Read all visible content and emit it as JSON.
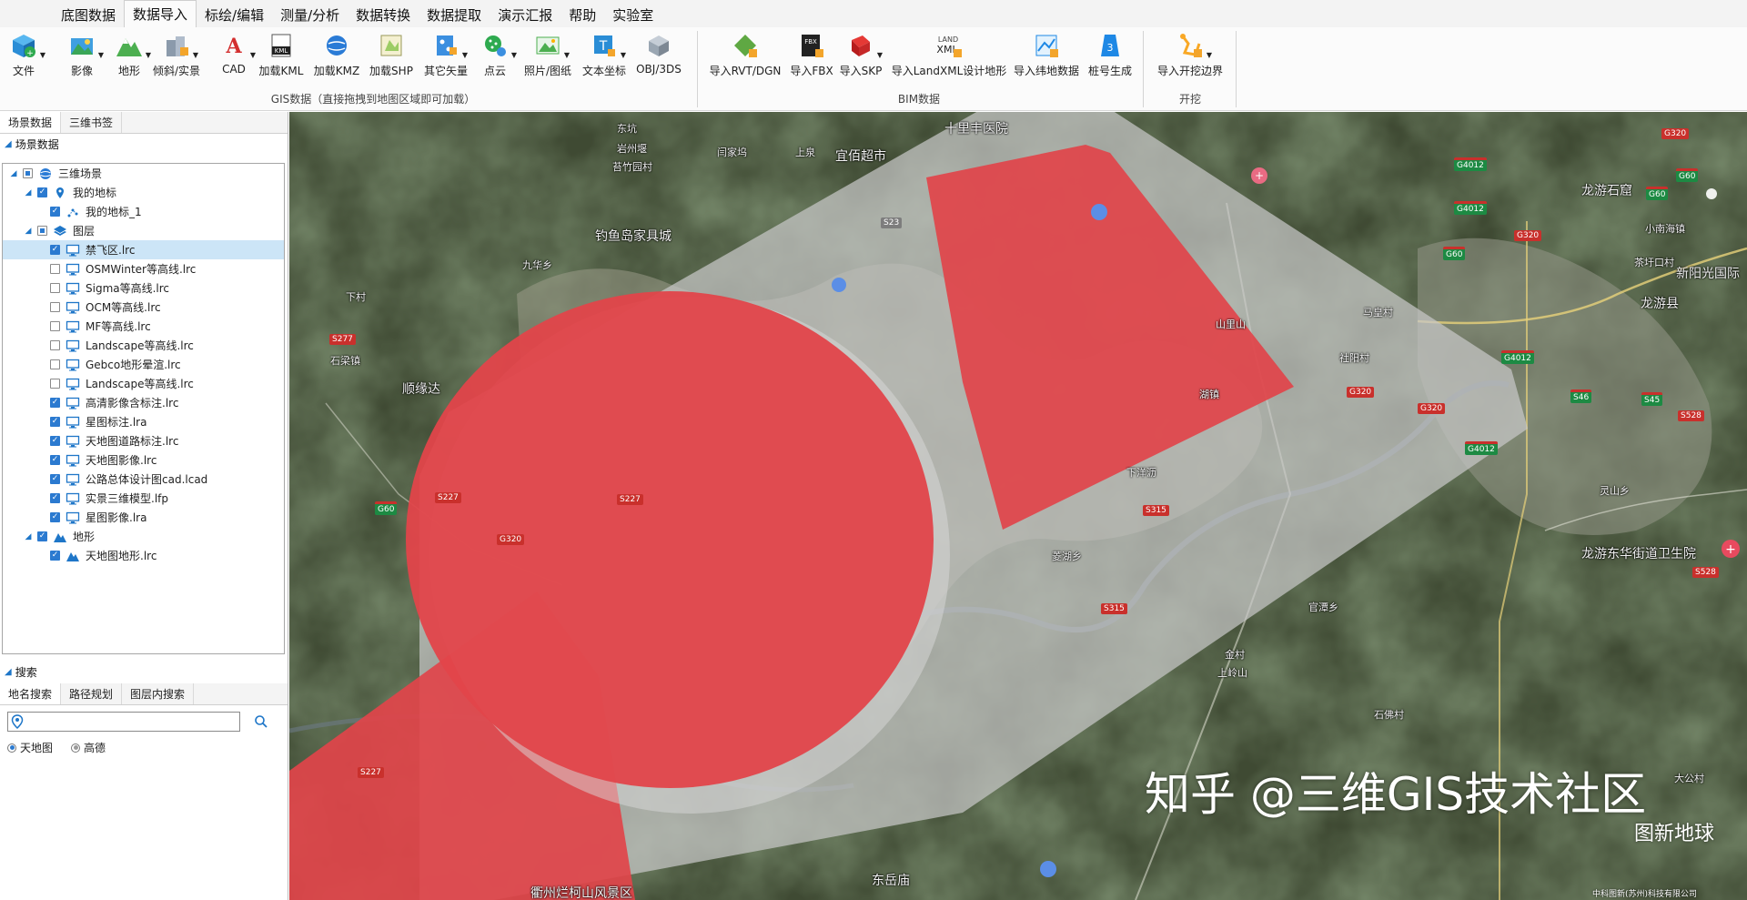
{
  "menu": {
    "tabs": [
      "底图数据",
      "数据导入",
      "标绘/编辑",
      "测量/分析",
      "数据转换",
      "数据提取",
      "演示汇报",
      "帮助",
      "实验室"
    ],
    "active_index": 1
  },
  "ribbon": {
    "file_label": "文件",
    "gis_buttons": [
      "影像",
      "地形",
      "倾斜/实景",
      "CAD",
      "加载KML",
      "加载KMZ",
      "加载SHP",
      "其它矢量",
      "点云",
      "照片/图纸",
      "文本坐标",
      "OBJ/3DS"
    ],
    "gis_group_label": "GIS数据（直接拖拽到地图区域即可加载）",
    "bim_buttons": [
      "导入RVT/DGN",
      "导入FBX",
      "导入SKP",
      "导入LandXML设计地形",
      "导入纬地数据",
      "桩号生成"
    ],
    "bim_group_label": "BIM数据",
    "excavation_buttons": [
      "导入开挖边界"
    ],
    "excavation_group_label": "开挖",
    "icon_text": {
      "kml": "KML",
      "fbx": "FBX",
      "landxml_1": "LAND",
      "landxml_2": "XML",
      "stake": "3"
    }
  },
  "left_panel": {
    "tabs": [
      "场景数据",
      "三维书签"
    ],
    "section_title": "场景数据",
    "tree": [
      {
        "label": "三维场景",
        "level": 0,
        "expanded": true,
        "check": "partial",
        "icon": "globe-icon"
      },
      {
        "label": "我的地标",
        "level": 1,
        "expanded": true,
        "check": "checked",
        "icon": "placemark-icon"
      },
      {
        "label": "我的地标_1",
        "level": 2,
        "check": "checked",
        "icon": "polyline-icon"
      },
      {
        "label": "图层",
        "level": 1,
        "expanded": true,
        "check": "partial",
        "icon": "layers-icon"
      },
      {
        "label": "禁飞区.lrc",
        "level": 2,
        "check": "checked",
        "icon": "monitor-icon",
        "selected": true
      },
      {
        "label": "OSMWinter等高线.lrc",
        "level": 2,
        "check": "unchecked",
        "icon": "monitor-icon"
      },
      {
        "label": "Sigma等高线.lrc",
        "level": 2,
        "check": "unchecked",
        "icon": "monitor-icon"
      },
      {
        "label": "OCM等高线.lrc",
        "level": 2,
        "check": "unchecked",
        "icon": "monitor-icon"
      },
      {
        "label": "MF等高线.lrc",
        "level": 2,
        "check": "unchecked",
        "icon": "monitor-icon"
      },
      {
        "label": "Landscape等高线.lrc",
        "level": 2,
        "check": "unchecked",
        "icon": "monitor-icon"
      },
      {
        "label": "Gebco地形晕渲.lrc",
        "level": 2,
        "check": "unchecked",
        "icon": "monitor-icon"
      },
      {
        "label": "Landscape等高线.lrc",
        "level": 2,
        "check": "unchecked",
        "icon": "monitor-icon"
      },
      {
        "label": "高清影像含标注.lrc",
        "level": 2,
        "check": "checked",
        "icon": "monitor-icon"
      },
      {
        "label": "星图标注.lra",
        "level": 2,
        "check": "checked",
        "icon": "monitor-icon"
      },
      {
        "label": "天地图道路标注.lrc",
        "level": 2,
        "check": "checked",
        "icon": "monitor-icon"
      },
      {
        "label": "天地图影像.lrc",
        "level": 2,
        "check": "checked",
        "icon": "monitor-icon"
      },
      {
        "label": "公路总体设计图cad.lcad",
        "level": 2,
        "check": "checked",
        "icon": "monitor-icon"
      },
      {
        "label": "实景三维模型.lfp",
        "level": 2,
        "check": "checked",
        "icon": "monitor-icon"
      },
      {
        "label": "星图影像.lra",
        "level": 2,
        "check": "checked",
        "icon": "monitor-icon"
      },
      {
        "label": "地形",
        "level": 1,
        "expanded": true,
        "check": "checked",
        "icon": "terrain-icon"
      },
      {
        "label": "天地图地形.lrc",
        "level": 2,
        "check": "checked",
        "icon": "terrain-icon"
      }
    ]
  },
  "search": {
    "section_title": "搜索",
    "tabs": [
      "地名搜索",
      "路径规划",
      "图层内搜索"
    ],
    "input_value": "",
    "providers": [
      {
        "label": "天地图",
        "selected": true
      },
      {
        "label": "高德",
        "selected": false
      }
    ]
  },
  "map": {
    "labels": [
      {
        "text": "十里丰医院",
        "cls": "mid"
      },
      {
        "text": "宜佰超市",
        "cls": "mid"
      },
      {
        "text": "钓鱼岛家具城",
        "cls": "mid"
      },
      {
        "text": "顺缘达",
        "cls": "mid"
      },
      {
        "text": "龙游石窟",
        "cls": "mid"
      },
      {
        "text": "新阳光国际",
        "cls": "mid"
      },
      {
        "text": "龙游县",
        "cls": "mid"
      },
      {
        "text": "龙游东华街道卫生院",
        "cls": "mid"
      },
      {
        "text": "东岳庙",
        "cls": "mid"
      },
      {
        "text": "衢州烂柯山风景区",
        "cls": "mid"
      },
      {
        "text": "东坑",
        "cls": ""
      },
      {
        "text": "岩州堰",
        "cls": ""
      },
      {
        "text": "苔竹园村",
        "cls": ""
      },
      {
        "text": "闫家坞",
        "cls": ""
      },
      {
        "text": "上泉",
        "cls": ""
      },
      {
        "text": "九华乡",
        "cls": ""
      },
      {
        "text": "下村",
        "cls": ""
      },
      {
        "text": "石梁镇",
        "cls": ""
      },
      {
        "text": "小南海镇",
        "cls": ""
      },
      {
        "text": "茶圩口村",
        "cls": ""
      },
      {
        "text": "湖镇",
        "cls": ""
      },
      {
        "text": "社阳村",
        "cls": ""
      },
      {
        "text": "山里山",
        "cls": ""
      },
      {
        "text": "马皇村",
        "cls": ""
      },
      {
        "text": "下洋沥",
        "cls": ""
      },
      {
        "text": "菱湖乡",
        "cls": ""
      },
      {
        "text": "官潭乡",
        "cls": ""
      },
      {
        "text": "金村",
        "cls": ""
      },
      {
        "text": "上岭山",
        "cls": ""
      },
      {
        "text": "石佛村",
        "cls": ""
      },
      {
        "text": "灵山乡",
        "cls": ""
      },
      {
        "text": "大公村",
        "cls": ""
      }
    ],
    "road_badges": [
      {
        "text": "G320",
        "style": "red"
      },
      {
        "text": "G4012",
        "style": "green"
      },
      {
        "text": "G60",
        "style": "green"
      },
      {
        "text": "G60",
        "style": "green"
      },
      {
        "text": "G4012",
        "style": "green"
      },
      {
        "text": "G320",
        "style": "red"
      },
      {
        "text": "G60",
        "style": "green"
      },
      {
        "text": "G4012",
        "style": "green"
      },
      {
        "text": "S46",
        "style": "green"
      },
      {
        "text": "S45",
        "style": "green"
      },
      {
        "text": "S528",
        "style": "red"
      },
      {
        "text": "G4012",
        "style": "green"
      },
      {
        "text": "G320",
        "style": "red"
      },
      {
        "text": "G320",
        "style": "red"
      },
      {
        "text": "S23",
        "style": "gray"
      },
      {
        "text": "S277",
        "style": "red"
      },
      {
        "text": "S227",
        "style": "red"
      },
      {
        "text": "G60",
        "style": "green"
      },
      {
        "text": "G320",
        "style": "red"
      },
      {
        "text": "S227",
        "style": "red"
      },
      {
        "text": "S315",
        "style": "red"
      },
      {
        "text": "S315",
        "style": "red"
      },
      {
        "text": "S528",
        "style": "red"
      },
      {
        "text": "S227",
        "style": "red"
      }
    ],
    "colors": {
      "no_fly_zone": "#e1444a",
      "buffer": "#c8c8c8"
    },
    "watermark": "知乎 @三维GIS技术社区",
    "brand": "图新地球",
    "copyright": "中科图新(苏州)科技有限公司"
  }
}
